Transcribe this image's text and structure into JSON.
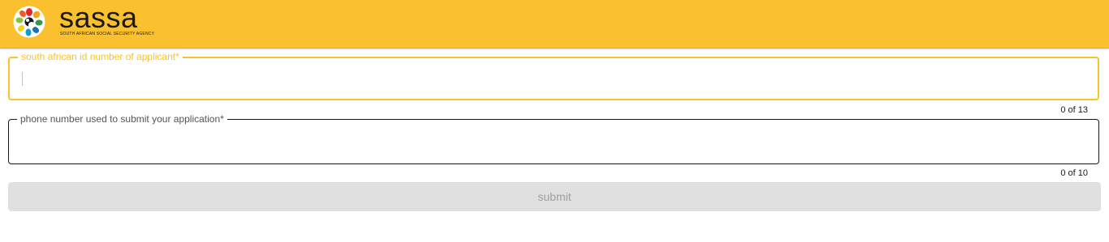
{
  "header": {
    "brand": "sassa",
    "brand_subtitle": "SOUTH AFRICAN SOCIAL SECURITY AGENCY",
    "background_color": "#fac02e",
    "logo_icon": "sassa-hands-emblem-icon"
  },
  "form": {
    "id_field": {
      "label": "south african id number of applicant*",
      "value": "",
      "counter": "0 of 13",
      "state": "focused"
    },
    "phone_field": {
      "label": "phone number used to submit your application*",
      "value": "",
      "counter": "0 of 10",
      "state": "normal"
    },
    "submit_label": "submit",
    "submit_state": "disabled"
  },
  "colors": {
    "accent": "#fac02e",
    "disabled_bg": "#e0e0e0",
    "disabled_text": "#a0a0a0"
  }
}
